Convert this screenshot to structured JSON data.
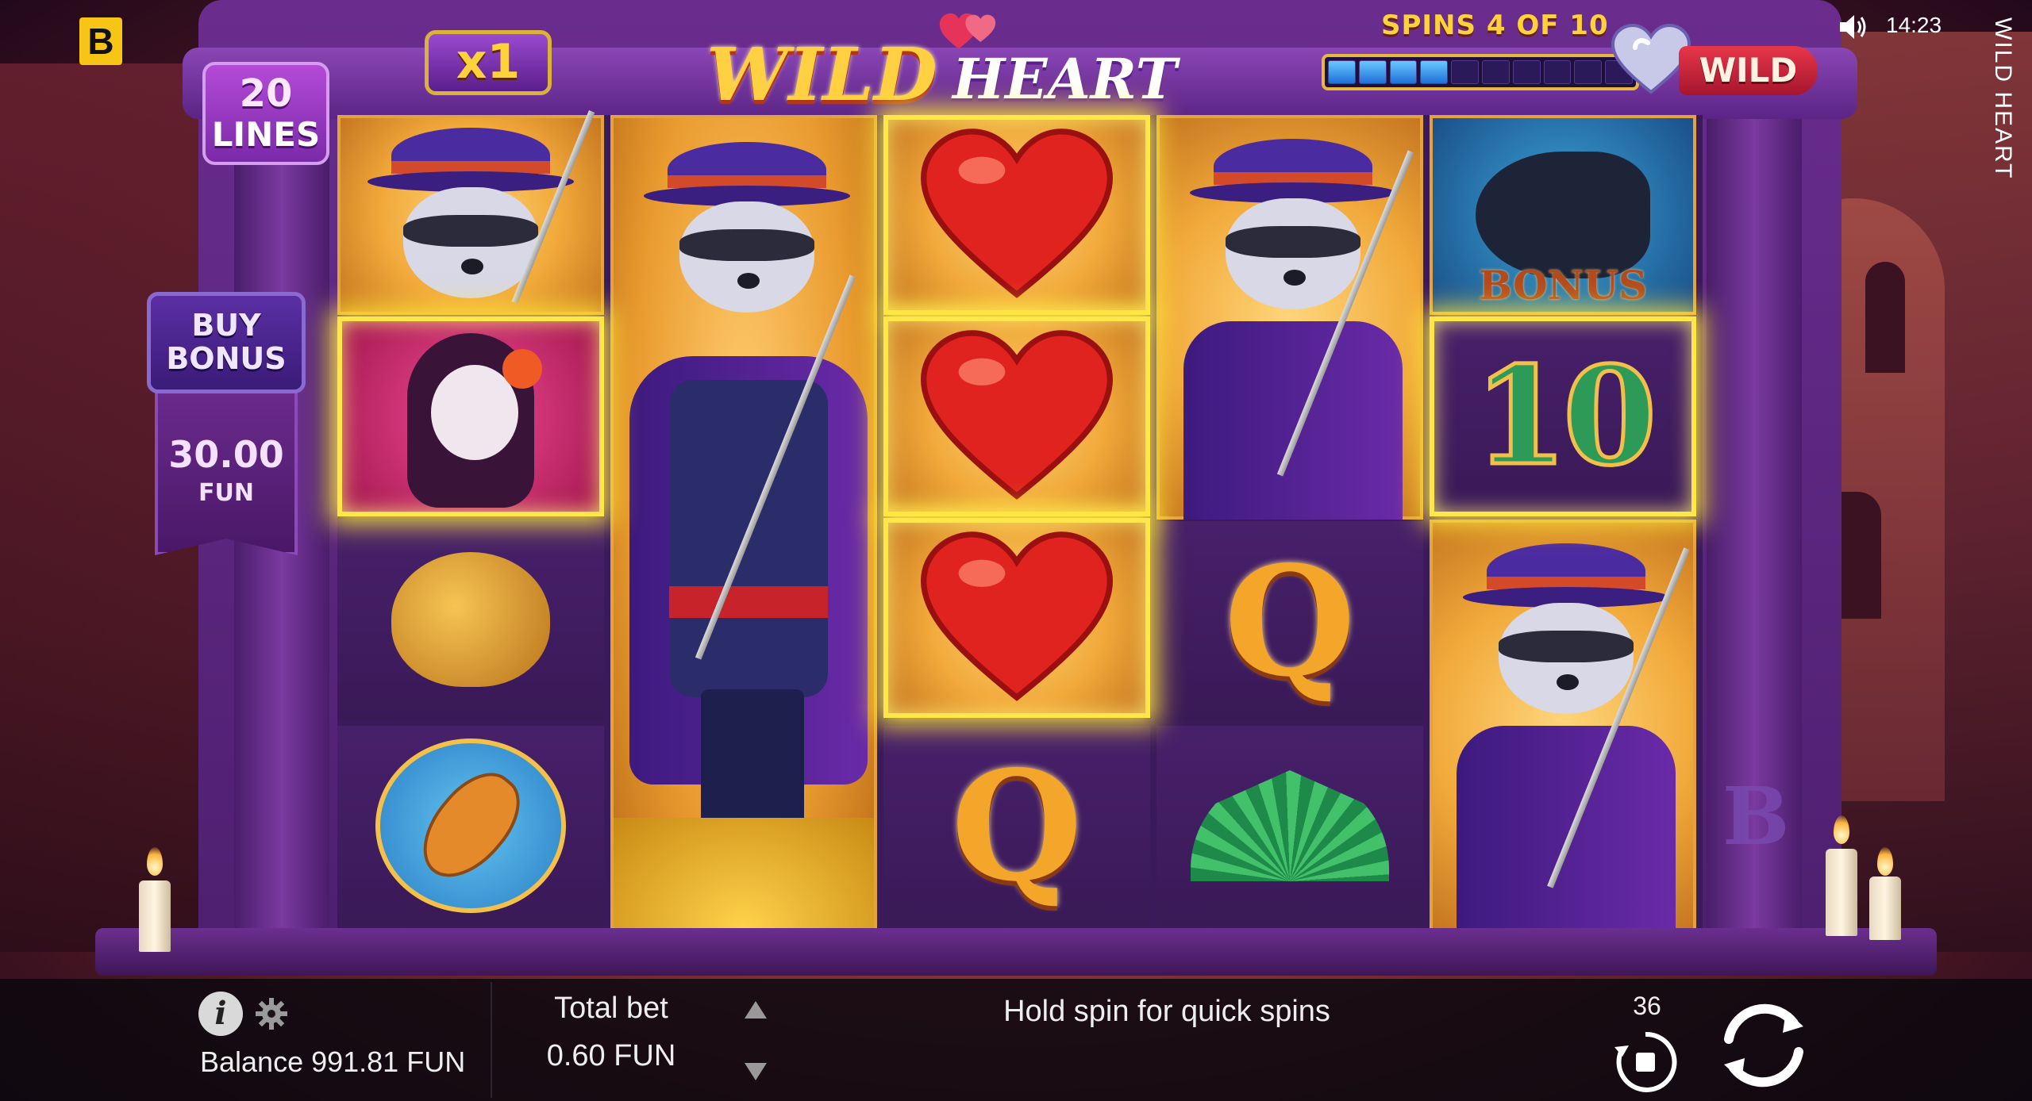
{
  "brand": {
    "logo_letter": "B"
  },
  "header": {
    "lines_number": "20",
    "lines_label": "LINES",
    "multiplier": "x1",
    "title_wild": "WILD",
    "title_heart": "HEART",
    "spins_label": "SPINS 4 OF 10",
    "spins_current": 4,
    "spins_total": 10,
    "wild_label": "WILD"
  },
  "status_bar": {
    "clock": "14:23",
    "side_title": "WILD HEART"
  },
  "buy_bonus": {
    "label_line1": "BUY",
    "label_line2": "BONUS",
    "price": "30.00",
    "currency": "FUN"
  },
  "reels": [
    {
      "cells": [
        "raccoon",
        "lady",
        "gold-bag",
        "guitar"
      ],
      "highlighted": [
        1
      ]
    },
    {
      "cells": [
        "raccoon-tall"
      ],
      "highlighted": []
    },
    {
      "cells": [
        "heart",
        "heart",
        "heart",
        "Q"
      ],
      "highlighted": [
        0,
        1,
        2
      ]
    },
    {
      "cells": [
        "raccoon",
        "raccoon",
        "Q",
        "fan"
      ],
      "highlighted": []
    },
    {
      "cells": [
        "horse-bonus",
        "10",
        "raccoon",
        "raccoon"
      ],
      "highlighted": [
        1
      ]
    }
  ],
  "symbols": {
    "q_letter": "Q",
    "ten_value": "10",
    "bonus_label": "BONUS",
    "emblem": "B"
  },
  "bottom_bar": {
    "info_glyph": "i",
    "balance_text": "Balance 991.81 FUN",
    "total_bet_label": "Total bet",
    "total_bet_value": "0.60 FUN",
    "hint": "Hold spin for quick spins",
    "autospin_count": "36"
  },
  "colors": {
    "accent_gold": "#ffd23c",
    "frame_purple": "#5b2485",
    "glow_yellow": "#ffe64a",
    "progress_blue": "#1f6fd8"
  }
}
